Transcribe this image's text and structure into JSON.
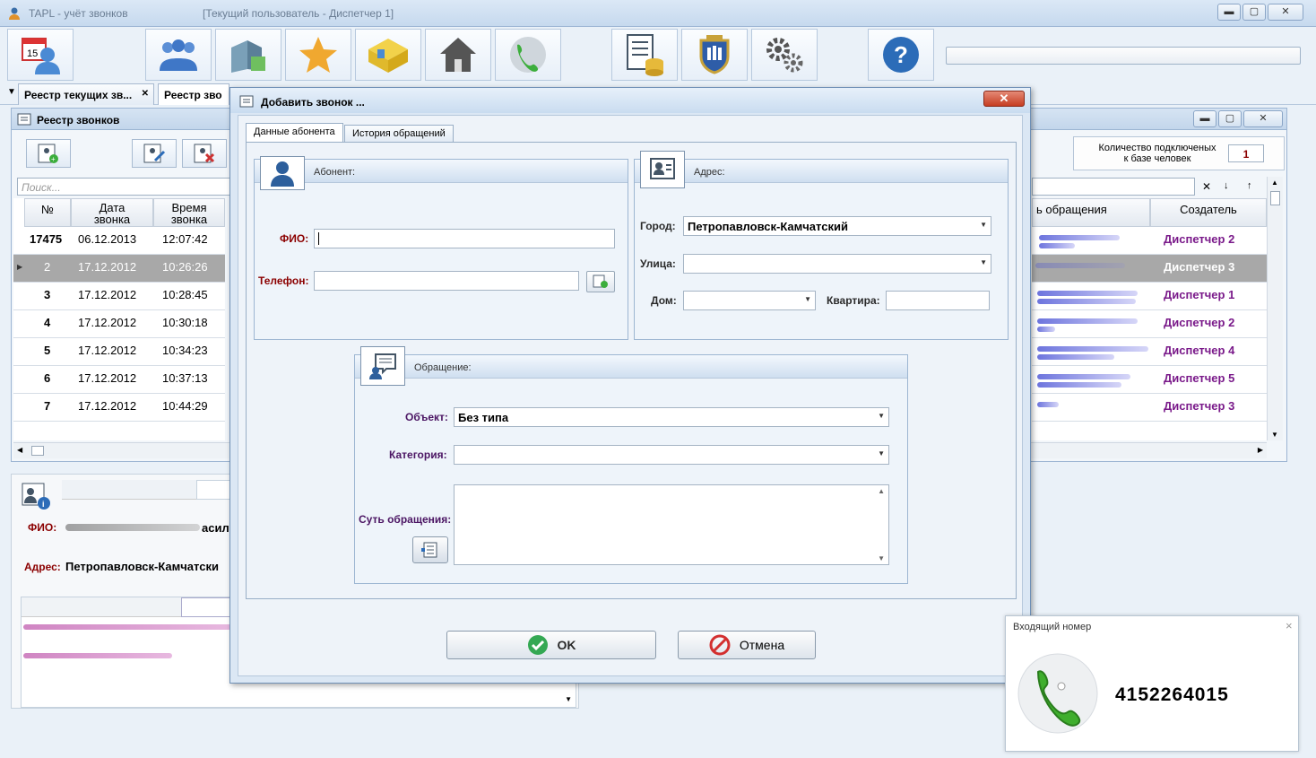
{
  "window": {
    "title": "TAPL - учёт звонков",
    "user": "[Текущий пользователь - Диспетчер 1]",
    "btn_min": "▬",
    "btn_max": "▢",
    "btn_close": "✕"
  },
  "tabs": [
    {
      "label": "Реестр текущих зв...",
      "close": "✕"
    },
    {
      "label": "Реестр зво"
    }
  ],
  "registry": {
    "title": "Реестр звонков",
    "search_placeholder": "Поиск...",
    "columns": [
      "№",
      "Дата\nзвонка",
      "Время\nзвонка"
    ],
    "right_columns": [
      "ь обращения",
      "Создатель"
    ],
    "rows": [
      {
        "num": "17475",
        "date": "06.12.2013",
        "time": "12:07:42",
        "creator": "Диспетчер 2"
      },
      {
        "num": "2",
        "date": "17.12.2012",
        "time": "10:26:26",
        "creator": "Диспетчер 3"
      },
      {
        "num": "3",
        "date": "17.12.2012",
        "time": "10:28:45",
        "creator": "Диспетчер 1"
      },
      {
        "num": "4",
        "date": "17.12.2012",
        "time": "10:30:18",
        "creator": "Диспетчер 2"
      },
      {
        "num": "5",
        "date": "17.12.2012",
        "time": "10:34:23",
        "creator": "Диспетчер 4"
      },
      {
        "num": "6",
        "date": "17.12.2012",
        "time": "10:37:13",
        "creator": "Диспетчер 5"
      },
      {
        "num": "7",
        "date": "17.12.2012",
        "time": "10:44:29",
        "creator": "Диспетчер 3"
      }
    ],
    "connected_label": "Количество подключеных\nк базе человек",
    "connected_count": "1"
  },
  "details": {
    "fio_label": "ФИО:",
    "fio_value": "асил",
    "address_label": "Адрес:",
    "address_value": "Петропавловск-Камчатски"
  },
  "dialog": {
    "title": "Добавить звонок ...",
    "close": "✕",
    "tabs": [
      "Данные абонента",
      "История обращений"
    ],
    "subscriber": {
      "header": "Абонент:",
      "fio_label": "ФИО:",
      "phone_label": "Телефон:"
    },
    "address": {
      "header": "Адрес:",
      "city_label": "Город:",
      "city_value": "Петропавловск-Камчатский",
      "street_label": "Улица:",
      "house_label": "Дом:",
      "apt_label": "Квартира:"
    },
    "request": {
      "header": "Обращение:",
      "object_label": "Объект:",
      "object_value": "Без типа",
      "category_label": "Категория:",
      "essence_label": "Суть обращения:"
    },
    "ok": "OK",
    "cancel": "Отмена"
  },
  "incoming": {
    "title": "Входящий номер",
    "number": "4152264015",
    "close": "×"
  }
}
